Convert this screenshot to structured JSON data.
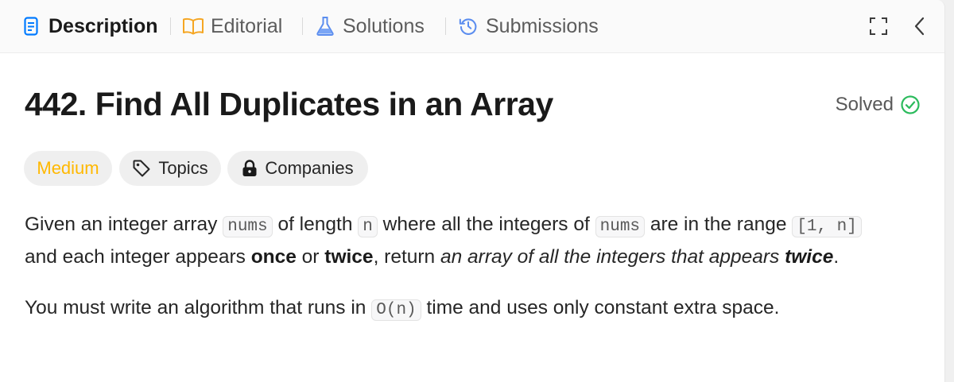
{
  "tabs": [
    {
      "label": "Description",
      "icon": "description-icon",
      "active": true
    },
    {
      "label": "Editorial",
      "icon": "book-icon"
    },
    {
      "label": "Solutions",
      "icon": "flask-icon"
    },
    {
      "label": "Submissions",
      "icon": "history-icon"
    }
  ],
  "problem": {
    "title": "442. Find All Duplicates in an Array",
    "status": "Solved",
    "difficulty": "Medium",
    "topics_label": "Topics",
    "companies_label": "Companies"
  },
  "description": {
    "p1": {
      "t1": "Given an integer array ",
      "c1": "nums",
      "t2": " of length ",
      "c2": "n",
      "t3": " where all the integers of ",
      "c3": "nums",
      "t4": " are in the range ",
      "c4": "[1, n]",
      "t5": "and each integer appears ",
      "b1": "once",
      "t6": " or ",
      "b2": "twice",
      "t7": ", return ",
      "i1": "an array of all the integers that appears ",
      "i2": "twice",
      "t8": "."
    },
    "p2": {
      "t1": "You must write an algorithm that runs in ",
      "c1": "O(n)",
      "t2": " time and uses only constant extra space."
    }
  },
  "colors": {
    "difficulty_medium": "#ffb800",
    "solved_check": "#2cbb5d",
    "description_icon": "#007aff"
  }
}
